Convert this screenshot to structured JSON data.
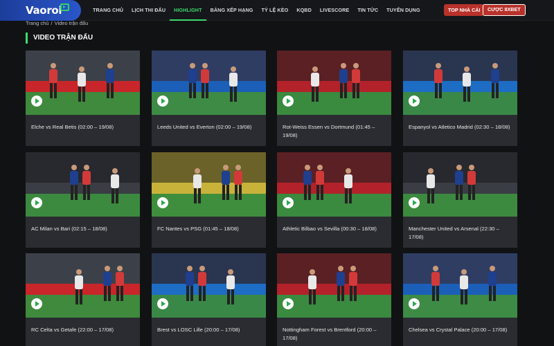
{
  "header": {
    "logo_text": "Vaoroi",
    "nav": [
      "Trang chủ",
      "Lịch thi đấu",
      "Highlight",
      "Bảng xếp hạng",
      "Tỷ lệ kèo",
      "KQBD",
      "Livescore",
      "Tin tức",
      "Tuyển dụng"
    ],
    "active_nav": "Highlight",
    "btn_top": "TOP NHÀ CÁI",
    "btn_cuoc": "CƯỢC 8XBET"
  },
  "breadcrumb": {
    "home": "Trang chủ",
    "separator": "/",
    "current": "Video trận đấu"
  },
  "section_title": "VIDEO TRẬN ĐẤU",
  "colors": {
    "accent": "#3ddc6b",
    "button_red": "#b8312a",
    "card_bg": "#2a2c31",
    "page_bg": "#111214"
  },
  "videos": [
    {
      "title": "Elche vs Real Betis (02:00 – 19/08)",
      "scene": "red-boards"
    },
    {
      "title": "Leeds United vs Everton (02:00 – 19/08)",
      "scene": "blue-stand"
    },
    {
      "title": "Rot-Weiss Essen vs Dortmund (01:45 – 19/08)",
      "scene": "red-stand"
    },
    {
      "title": "Espanyol vs Atletico Madrid (02:30 – 18/08)",
      "scene": "blue-boards"
    },
    {
      "title": "AC Milan vs Bari (02:15 – 18/08)",
      "scene": "dark-stand"
    },
    {
      "title": "FC Nantes vs PSG (01:45 – 18/08)",
      "scene": "yellow-stand"
    },
    {
      "title": "Athletic Bilbao vs Sevilla (00:30 – 18/08)",
      "scene": "red-stand"
    },
    {
      "title": "Manchester United vs Arsenal (22:30 – 17/08)",
      "scene": "dark-stand"
    },
    {
      "title": "RC Celta vs Getafe (22:00 – 17/08)",
      "scene": "red-boards"
    },
    {
      "title": "Brest vs LOSC Lille (20:00 – 17/08)",
      "scene": "blue-boards"
    },
    {
      "title": "Nottingham Forest vs Brentford (20:00 – 17/08)",
      "scene": "red-stand"
    },
    {
      "title": "Chelsea vs Crystal Palace (20:00 – 17/08)",
      "scene": "blue-stand"
    }
  ]
}
